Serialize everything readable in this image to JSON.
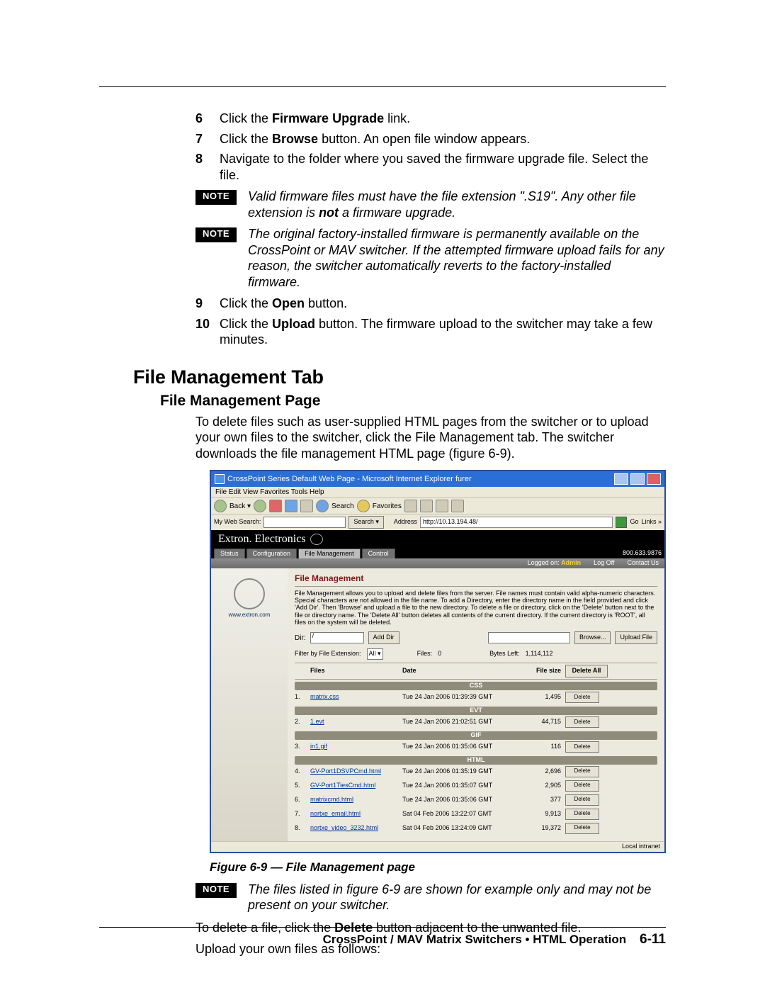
{
  "steps": {
    "s6": {
      "n": "6",
      "pre": "Click the ",
      "bold": "Firmware Upgrade",
      "post": " link."
    },
    "s7": {
      "n": "7",
      "pre": "Click the ",
      "bold": "Browse",
      "post": " button.  An open file window appears."
    },
    "s8": {
      "n": "8",
      "txt": "Navigate to the folder where you saved the firmware upgrade file.  Select the file."
    },
    "s9": {
      "n": "9",
      "pre": "Click the ",
      "bold": "Open",
      "post": " button."
    },
    "s10": {
      "n": "10",
      "pre": "Click the ",
      "bold": "Upload",
      "post": " button.  The firmware upload to the switcher may take a few minutes."
    }
  },
  "notes": {
    "note_label": "NOTE",
    "n1": "Valid firmware files must have the file extension \".S19\".  Any other file extension is not a firmware upgrade.",
    "n2": "The original factory-installed firmware is permanently available on the CrossPoint or MAV switcher.  If the attempted firmware upload fails for any reason, the switcher automatically reverts to the factory-installed firmware.",
    "n3": "The files listed in figure 6-9 are shown for example only and may not be present on your switcher."
  },
  "section_h2": "File Management Tab",
  "section_h3": "File Management Page",
  "intro": "To delete files such as user-supplied HTML pages from the switcher or to upload your own files to the switcher, click the File Management tab.  The switcher downloads the file management HTML page (figure 6-9).",
  "shot": {
    "title": "CrossPoint Series Default Web Page - Microsoft Internet Explorer furer",
    "menubar": "File   Edit   View   Favorites   Tools   Help",
    "back": "Back ▾",
    "search_btn": "Search",
    "fav_btn": "Favorites",
    "addr_label": "Address",
    "addr": "http://10.13.194.48/",
    "go": "Go",
    "links": "Links »",
    "mws": "My Web Search:",
    "msearch": "Search ▾",
    "brand": "Extron. Electronics",
    "tabs": [
      "Status",
      "Configuration",
      "File Management",
      "Control"
    ],
    "active_tab": 2,
    "phone": "800.633.9876",
    "logged": "Logged on: Admin",
    "logoff": "Log Off",
    "contact": "Contact Us",
    "leftlink": "www.extron.com",
    "fm_header": "File Management",
    "fm_desc": "File Management allows you to upload and delete files from the server. File names must contain valid alpha-numeric characters. Special characters are not allowed in the file name. To add a Directory, enter the directory name in the field provided and click 'Add Dir'. Then 'Browse' and upload a file to the new directory. To delete a file or directory, click on the 'Delete' button next to the file or directory name. The 'Delete All' button deletes all contents of the current directory. If the current directory is 'ROOT', all files on the system will be deleted.",
    "dir_label": "Dir:",
    "dir_val": "/",
    "add_dir": "Add Dir",
    "browse": "Browse...",
    "upload": "Upload File",
    "filter_label": "Filter by File Extension:",
    "filter_val": "All ▾",
    "files_label": "Files:",
    "files_count": "0",
    "bytes_label": "Bytes Left:",
    "bytes": "1,114,112",
    "cols": {
      "files": "Files",
      "date": "Date",
      "size": "File size",
      "del": "Delete All"
    },
    "groups": [
      "CSS",
      "EVT",
      "GIF",
      "HTML"
    ],
    "rows": [
      {
        "g": 0,
        "n": "1.",
        "name": "matrix.css",
        "date": "Tue 24 Jan 2006 01:39:39 GMT",
        "size": "1,495"
      },
      {
        "g": 1,
        "n": "2.",
        "name": "1.evt",
        "date": "Tue 24 Jan 2006 21:02:51 GMT",
        "size": "44,715"
      },
      {
        "g": 2,
        "n": "3.",
        "name": "in1.gif",
        "date": "Tue 24 Jan 2006 01:35:06 GMT",
        "size": "116"
      },
      {
        "g": 3,
        "n": "4.",
        "name": "GV-Port1DSVPCmd.html",
        "date": "Tue 24 Jan 2006 01:35:19 GMT",
        "size": "2,696"
      },
      {
        "g": 3,
        "n": "5.",
        "name": "GV-Port1TiesCmd.html",
        "date": "Tue 24 Jan 2006 01:35:07 GMT",
        "size": "2,905"
      },
      {
        "g": 3,
        "n": "6.",
        "name": "matrixcmd.html",
        "date": "Tue 24 Jan 2006 01:35:06 GMT",
        "size": "377"
      },
      {
        "g": 3,
        "n": "7.",
        "name": "nortxe_email.html",
        "date": "Sat 04 Feb 2006 13:22:07 GMT",
        "size": "9,913"
      },
      {
        "g": 3,
        "n": "8.",
        "name": "nortxe_video_3232.html",
        "date": "Sat 04 Feb 2006 13:24:09 GMT",
        "size": "19,372"
      }
    ],
    "delete": "Delete",
    "status": "Local intranet"
  },
  "caption": "Figure 6-9 — File Management page",
  "post1_pre": "To delete a file, click the ",
  "post1_bold": "Delete",
  "post1_post": " button adjacent to the unwanted file.",
  "post2": "Upload your own files as follows:",
  "footer_text": "CrossPoint / MAV Matrix Switchers • HTML Operation",
  "footer_page": "6-11"
}
